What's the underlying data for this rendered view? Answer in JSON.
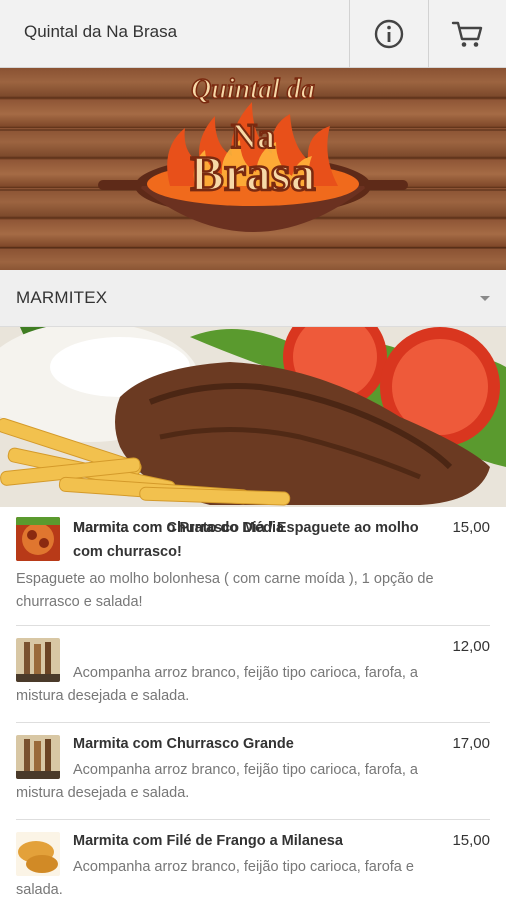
{
  "header": {
    "title": "Quintal da Na Brasa",
    "info_icon": "info-icon",
    "cart_icon": "cart-icon"
  },
  "banner": {
    "logo_line1": "Quintal da",
    "logo_line2": "Na",
    "logo_line3": "Brasa"
  },
  "category": {
    "label": "MARMITEX",
    "dropdown_icon": "caret-down-icon"
  },
  "menu": {
    "items": [
      {
        "name": "Marmita com o Prato do Dia / Espaguete ao molho com churrasco!",
        "price": "15,00",
        "description": "Espaguete ao molho bolonhesa ( com carne moída ), 1 opção de churrasco e salada!"
      },
      {
        "name": "Marmita com Churrasco Média",
        "price": "12,00",
        "description": "Acompanha arroz branco, feijão tipo carioca, farofa, a mistura desejada e salada."
      },
      {
        "name": "Marmita com Churrasco Grande",
        "price": "17,00",
        "description": "Acompanha arroz branco, feijão tipo carioca, farofa, a mistura desejada e salada."
      },
      {
        "name": "Marmita com Filé de Frango a Milanesa",
        "price": "15,00",
        "description": "Acompanha arroz branco, feijão tipo carioca, farofa e salada."
      }
    ]
  },
  "colors": {
    "flame_orange": "#f06a1c",
    "logo_cream": "#f7d9a8",
    "pan_brown": "#5e2a18"
  }
}
